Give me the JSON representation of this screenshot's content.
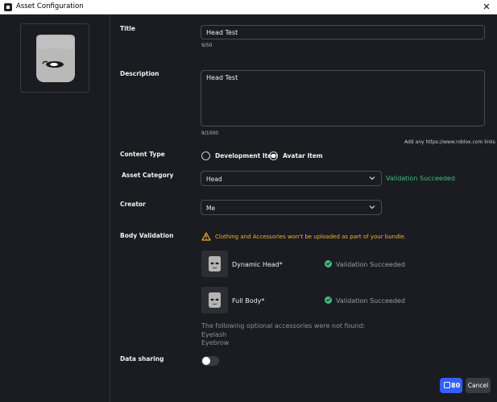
{
  "window": {
    "title": "Asset Configuration",
    "close_glyph": "✕"
  },
  "form": {
    "title": {
      "label": "Title",
      "value": "Head Test",
      "counter": "9/50"
    },
    "description": {
      "label": "Description",
      "value": "Head Test",
      "counter": "9/1000",
      "hint": "Add any https://www.roblox.com links"
    },
    "content_type": {
      "label": "Content Type",
      "options": [
        "Development Item",
        "Avatar Item"
      ],
      "selected": "Avatar Item"
    },
    "asset_category": {
      "label": "Asset Category",
      "value": "Head",
      "status": "Validation Succeeded"
    },
    "creator": {
      "label": "Creator",
      "value": "Me"
    },
    "body_validation": {
      "label": "Body Validation",
      "warning": "Clothing and Accessories won't be uploaded as part of your bundle.",
      "items": [
        {
          "name": "Dynamic Head*",
          "status": "Validation Succeeded"
        },
        {
          "name": "Full Body*",
          "status": "Validation Succeeded"
        }
      ],
      "missing_note": "The following optional accessories were not found:",
      "missing": [
        "Eyelash",
        "Eyebrow"
      ]
    },
    "data_sharing": {
      "label": "Data sharing",
      "enabled": false
    }
  },
  "footer": {
    "price": "80",
    "cancel_label": "Cancel"
  },
  "colors": {
    "background": "#1b1c21",
    "accent": "#335fff",
    "success": "#3fbf7f",
    "warning": "#f0b429"
  }
}
